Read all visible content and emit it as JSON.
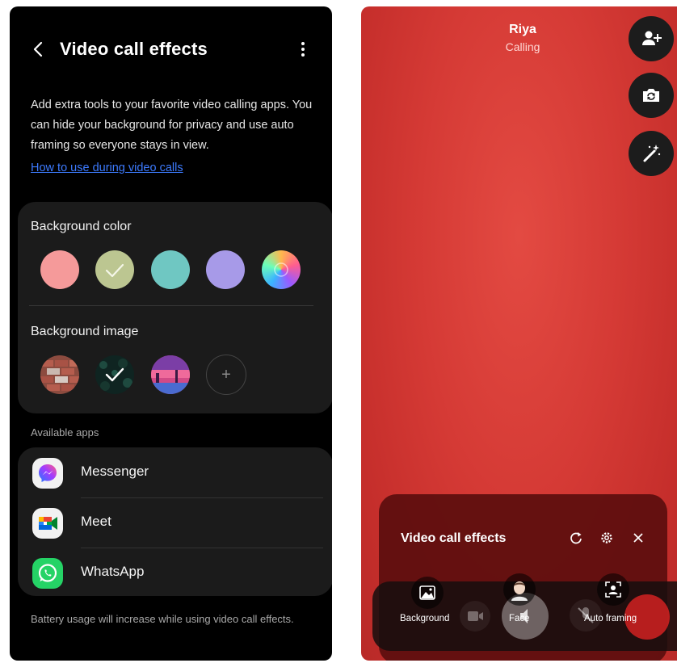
{
  "left": {
    "title": "Video call effects",
    "description": "Add extra tools to your favorite video calling apps. You can hide your background for privacy and use auto framing so everyone stays in view.",
    "link": "How to use during video calls",
    "background_color": {
      "label": "Background color",
      "swatches": [
        {
          "name": "pink",
          "color": "#f59a9a"
        },
        {
          "name": "sage",
          "color": "#bcc691",
          "selected": true
        },
        {
          "name": "teal",
          "color": "#6fc7c2"
        },
        {
          "name": "lavender",
          "color": "#a79ae8"
        },
        {
          "name": "gradient",
          "color": "custom"
        }
      ]
    },
    "background_image": {
      "label": "Background image",
      "add_symbol": "+"
    },
    "available_apps_label": "Available apps",
    "apps": [
      {
        "name": "Messenger"
      },
      {
        "name": "Meet"
      },
      {
        "name": "WhatsApp"
      }
    ],
    "battery_note": "Battery usage will increase while using video call effects."
  },
  "right": {
    "caller_name": "Riya",
    "call_status": "Calling",
    "panel": {
      "title": "Video call effects",
      "effects": [
        {
          "label": "Background"
        },
        {
          "label": "Face"
        },
        {
          "label": "Auto framing"
        }
      ]
    }
  },
  "colors": {
    "accent_link": "#3d7bff",
    "card": "#1b1b1b",
    "call_bg": "#d53a35",
    "panel": "#5c0e0e"
  }
}
